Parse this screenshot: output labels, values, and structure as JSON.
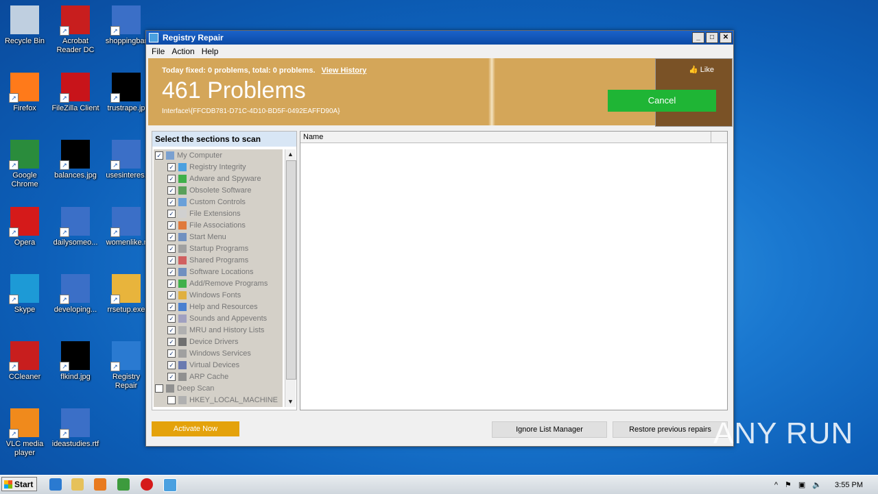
{
  "desktop": {
    "icons": [
      {
        "label": "Recycle Bin"
      },
      {
        "label": "Acrobat Reader DC"
      },
      {
        "label": "shoppingbar"
      },
      {
        "label": "Firefox"
      },
      {
        "label": "FileZilla Client"
      },
      {
        "label": "trustrape.jp"
      },
      {
        "label": "Google Chrome"
      },
      {
        "label": "balances.jpg"
      },
      {
        "label": "usesinteres."
      },
      {
        "label": "Opera"
      },
      {
        "label": "dailysomeo..."
      },
      {
        "label": "womenlike.r"
      },
      {
        "label": "Skype"
      },
      {
        "label": "developing..."
      },
      {
        "label": "rrsetup.exe"
      },
      {
        "label": "CCleaner"
      },
      {
        "label": "flkind.jpg"
      },
      {
        "label": "Registry Repair"
      },
      {
        "label": "VLC media player"
      },
      {
        "label": "ideastudies.rtf"
      }
    ]
  },
  "window": {
    "title": "Registry Repair",
    "menu": [
      "File",
      "Action",
      "Help"
    ],
    "banner": {
      "summary": "Today fixed: 0 problems, total: 0 problems.",
      "view_history": "View History",
      "problems": "461 Problems",
      "interface": "Interface\\{FFCDB781-D71C-4D10-BD5F-0492EAFFD90A}",
      "like": "Like",
      "cancel": "Cancel"
    },
    "sections_header": "Select the sections to scan",
    "tree": [
      {
        "label": "My Computer",
        "checked": true,
        "level": 0
      },
      {
        "label": "Registry Integrity",
        "checked": true,
        "level": 1
      },
      {
        "label": "Adware and Spyware",
        "checked": true,
        "level": 1
      },
      {
        "label": "Obsolete Software",
        "checked": true,
        "level": 1
      },
      {
        "label": "Custom Controls",
        "checked": true,
        "level": 1
      },
      {
        "label": "File Extensions",
        "checked": true,
        "level": 1
      },
      {
        "label": "File Associations",
        "checked": true,
        "level": 1
      },
      {
        "label": "Start Menu",
        "checked": true,
        "level": 1
      },
      {
        "label": "Startup Programs",
        "checked": true,
        "level": 1
      },
      {
        "label": "Shared Programs",
        "checked": true,
        "level": 1
      },
      {
        "label": "Software Locations",
        "checked": true,
        "level": 1
      },
      {
        "label": "Add/Remove Programs",
        "checked": true,
        "level": 1
      },
      {
        "label": "Windows Fonts",
        "checked": true,
        "level": 1
      },
      {
        "label": "Help and Resources",
        "checked": true,
        "level": 1
      },
      {
        "label": "Sounds and Appevents",
        "checked": true,
        "level": 1
      },
      {
        "label": "MRU and History Lists",
        "checked": true,
        "level": 1
      },
      {
        "label": "Device Drivers",
        "checked": true,
        "level": 1
      },
      {
        "label": "Windows Services",
        "checked": true,
        "level": 1
      },
      {
        "label": "Virtual Devices",
        "checked": true,
        "level": 1
      },
      {
        "label": "ARP Cache",
        "checked": true,
        "level": 1
      },
      {
        "label": "Deep Scan",
        "checked": false,
        "level": 0
      },
      {
        "label": "HKEY_LOCAL_MACHINE",
        "checked": false,
        "level": 1
      }
    ],
    "results_column": "Name",
    "buttons": {
      "activate": "Activate Now",
      "ignore": "Ignore List Manager",
      "restore": "Restore previous repairs"
    }
  },
  "watermark": "ANY RUN",
  "taskbar": {
    "start": "Start",
    "clock": "3:55 PM"
  }
}
